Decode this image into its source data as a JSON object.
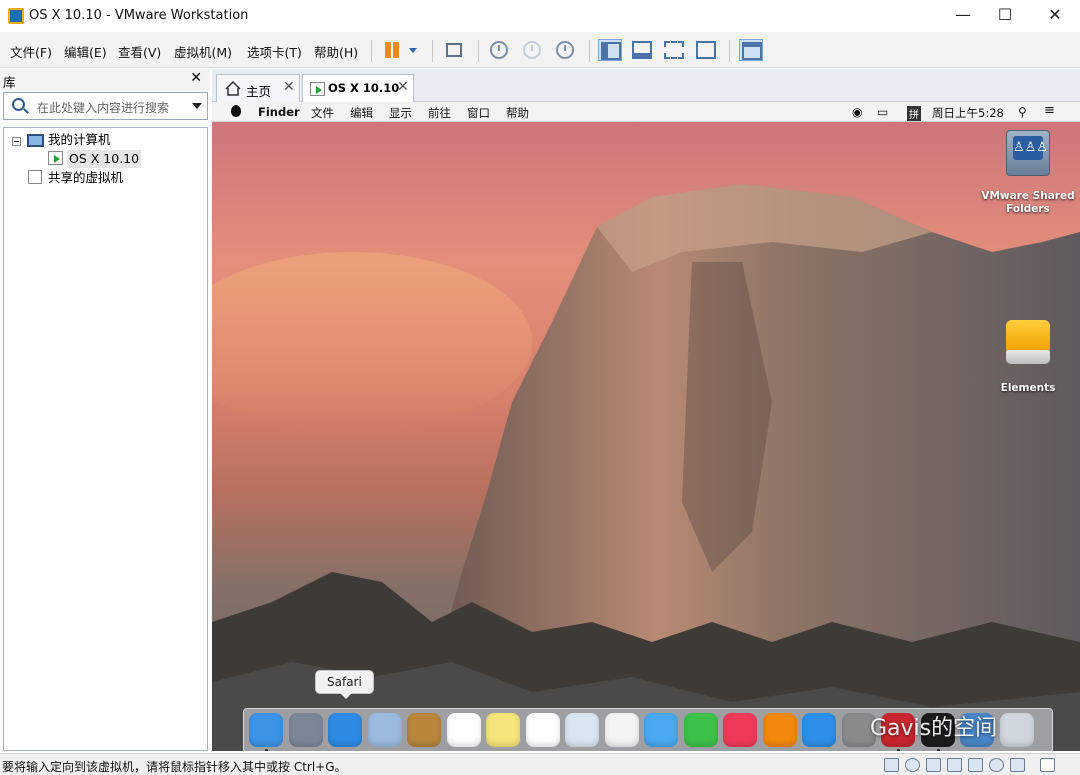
{
  "window": {
    "title": "OS X 10.10 - VMware Workstation"
  },
  "menu": [
    "文件(F)",
    "编辑(E)",
    "查看(V)",
    "虚拟机(M)",
    "选项卡(T)",
    "帮助(H)"
  ],
  "library": {
    "title": "库",
    "search_placeholder": "在此处键入内容进行搜索",
    "tree": {
      "root": "我的计算机",
      "vm": "OS X 10.10",
      "shared": "共享的虚拟机"
    }
  },
  "tabs": [
    {
      "label": "主页",
      "icon": "home-icon"
    },
    {
      "label": "OS X 10.10",
      "icon": "vm-icon",
      "active": true
    }
  ],
  "guest": {
    "menubar": {
      "app": "Finder",
      "items": [
        "文件",
        "编辑",
        "显示",
        "前往",
        "窗口",
        "帮助"
      ],
      "ime": "拼",
      "clock": "周日上午5:28"
    },
    "desktop_icons": [
      {
        "label_line1": "VMware Shared",
        "label_line2": "Folders",
        "icon": "shared-folder-icon"
      },
      {
        "label_line1": "Elements",
        "label_line2": "",
        "icon": "external-drive-icon"
      }
    ],
    "dock": {
      "tooltip": "Safari",
      "apps": [
        {
          "name": "finder-icon",
          "color": "#3d93e6",
          "running": true
        },
        {
          "name": "launchpad-icon",
          "color": "#7b8797"
        },
        {
          "name": "safari-icon",
          "color": "#2e8be3"
        },
        {
          "name": "mail-icon",
          "color": "#9bbbe0"
        },
        {
          "name": "contacts-icon",
          "color": "#b8863b"
        },
        {
          "name": "calendar-icon",
          "color": "#ffffff"
        },
        {
          "name": "notes-icon",
          "color": "#f6e57a"
        },
        {
          "name": "reminders-icon",
          "color": "#ffffff"
        },
        {
          "name": "preview-icon",
          "color": "#d9e6f2"
        },
        {
          "name": "photos-icon",
          "color": "#f4f4f4"
        },
        {
          "name": "messages-icon",
          "color": "#4aa9f0"
        },
        {
          "name": "facetime-icon",
          "color": "#3cc24a"
        },
        {
          "name": "itunes-icon",
          "color": "#f03a5a"
        },
        {
          "name": "ibooks-icon",
          "color": "#f2890c"
        },
        {
          "name": "app-store-icon",
          "color": "#2d8fe8"
        },
        {
          "name": "system-preferences-icon",
          "color": "#8a8a8a"
        },
        {
          "name": "photo-booth-icon",
          "color": "#c9262f",
          "running": true
        },
        {
          "name": "terminal-icon",
          "color": "#1c1c1c",
          "running": true
        },
        {
          "name": "downloads-stack-icon",
          "color": "#4a86c8"
        },
        {
          "name": "trash-icon",
          "color": "#cfd6de"
        }
      ]
    }
  },
  "watermark": "Gavis的空间",
  "statusbar": {
    "message": "要将输入定向到该虚拟机，请将鼠标指针移入其中或按 Ctrl+G。"
  }
}
